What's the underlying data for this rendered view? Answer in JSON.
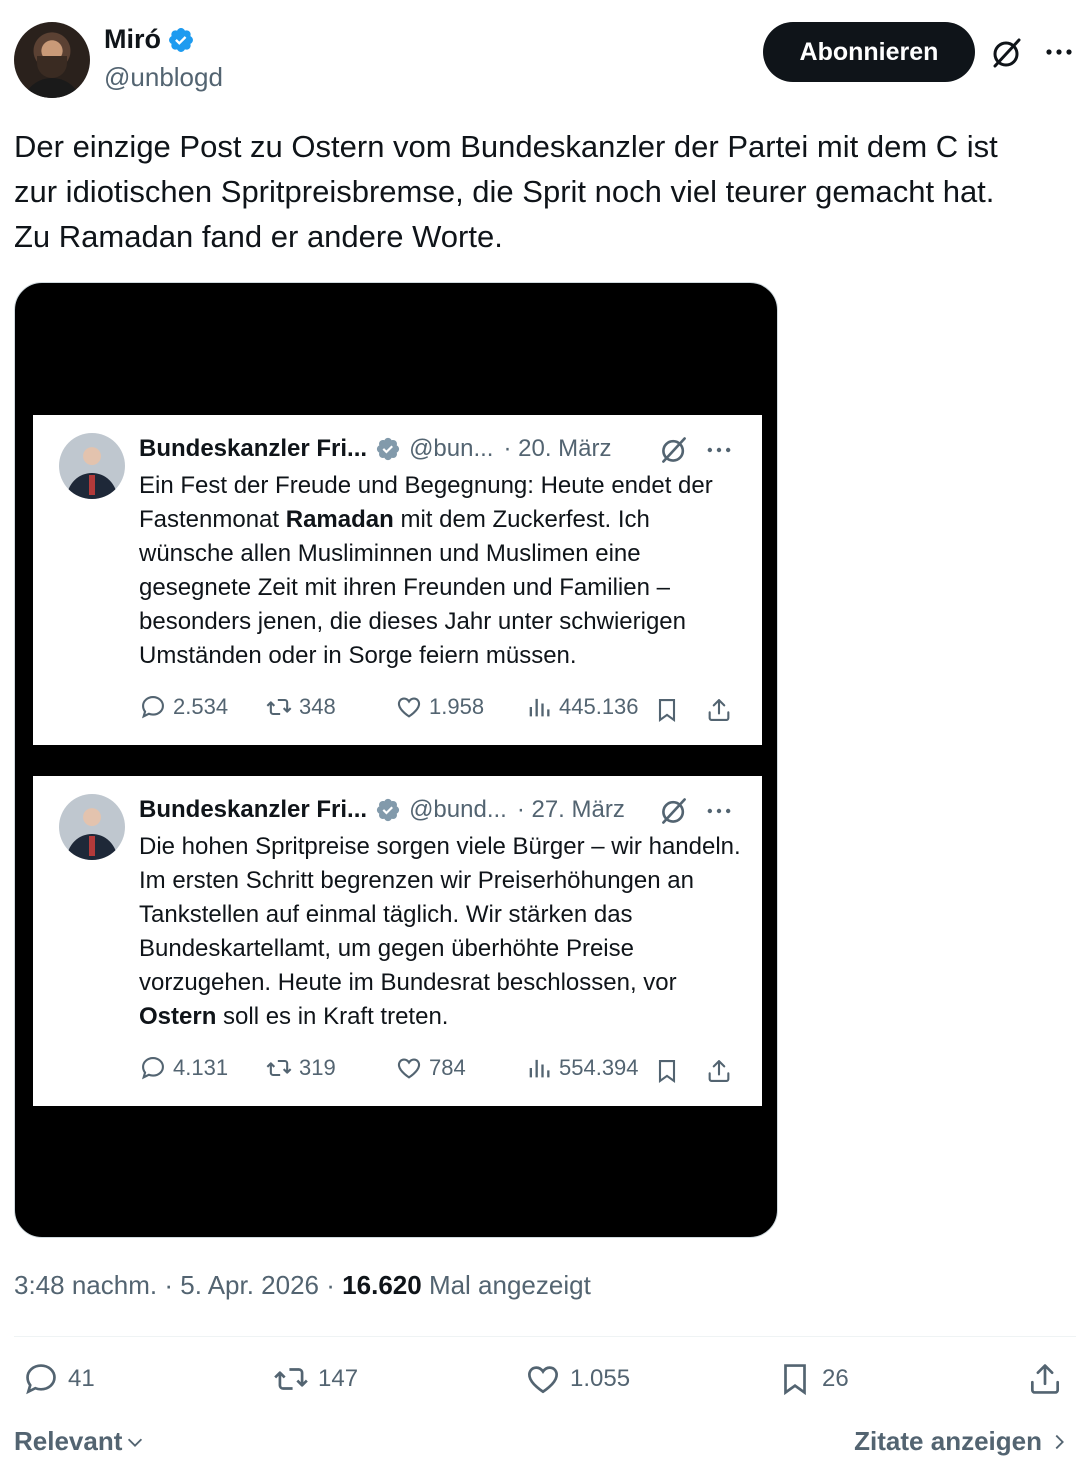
{
  "author": {
    "name": "Miró",
    "handle": "@unblogd"
  },
  "follow_label": "Abonnieren",
  "post_text": "Der einzige Post zu Ostern vom Bundeskanzler der Partei mit dem C ist\nzur idiotischen Spritpreisbremse, die Sprit noch viel teurer gemacht hat.\nZu Ramadan fand er andere Worte.",
  "embedded_posts": [
    {
      "name": "Bundeskanzler Fri...",
      "handle": "@bun...",
      "date": "· 20. März",
      "text_before": "Ein Fest der Freude und Begegnung: Heute endet der Fastenmonat ",
      "text_bold": "Ramadan",
      "text_after": " mit dem Zuckerfest. Ich wünsche allen Musliminnen und Muslimen eine gesegnete Zeit mit ihren Freunden und Familien – besonders jenen, die dieses Jahr unter schwierigen Umständen oder in Sorge feiern müssen.",
      "replies": "2.534",
      "reposts": "348",
      "likes": "1.958",
      "views": "445.136"
    },
    {
      "name": "Bundeskanzler Fri...",
      "handle": "@bund...",
      "date": "· 27. März",
      "text_before": "Die hohen Spritpreise sorgen viele Bürger – wir handeln. Im ersten Schritt begrenzen wir Preiserhöhungen an Tankstellen auf einmal täglich. Wir stärken das Bundeskartellamt, um gegen überhöhte Preise vorzugehen. Heute im Bundesrat beschlossen, vor ",
      "text_bold": "Ostern",
      "text_after": " soll es in Kraft treten.",
      "replies": "4.131",
      "reposts": "319",
      "likes": "784",
      "views": "554.394"
    }
  ],
  "meta": {
    "time": "3:48 nachm.",
    "date": "5. Apr. 2026",
    "sep": "·",
    "views_count": "16.620",
    "views_label": "Mal angezeigt"
  },
  "stats": {
    "replies": "41",
    "reposts": "147",
    "likes": "1.055",
    "bookmarks": "26"
  },
  "sort_label": "Relevant",
  "quotes_label": "Zitate anzeigen",
  "colors": {
    "text": "#0f1419",
    "secondary": "#536471",
    "verified": "#1d9bf0",
    "button_bg": "#0f1419"
  }
}
